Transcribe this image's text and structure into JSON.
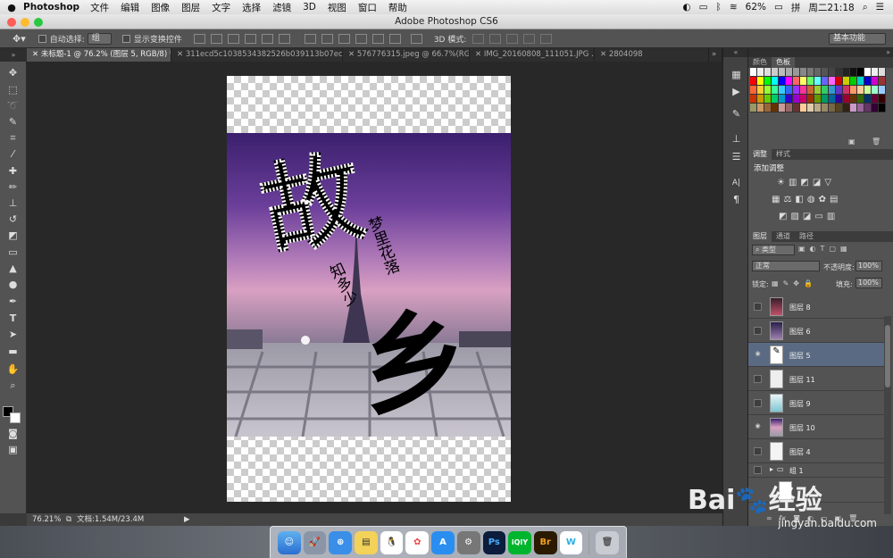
{
  "menubar": {
    "apple": "",
    "app": "Photoshop",
    "items": [
      "文件",
      "编辑",
      "图像",
      "图层",
      "文字",
      "选择",
      "滤镜",
      "3D",
      "视图",
      "窗口",
      "帮助"
    ],
    "battery": "62%",
    "input_method": "拼",
    "clock": "周二21:18"
  },
  "window": {
    "title": "Adobe Photoshop CS6"
  },
  "options": {
    "auto_select_label": "自动选择:",
    "auto_select_value": "组",
    "show_transform_label": "显示变换控件",
    "mode_3d_label": "3D 模式:",
    "workspace": "基本功能"
  },
  "tabs": [
    "未标题-1 @ 76.2% (图层 5, RGB/8) *",
    "311ecd5c1038534382526b039113b07eca808823.jpg",
    "576776315.jpeg @ 66.7%(RG...",
    "IMG_20160808_111051.JPG ...",
    "2804098"
  ],
  "tabs_overflow": "»",
  "status": {
    "zoom": "76.21%",
    "doc": "文档:1.54M/23.4M"
  },
  "swatch_panel": {
    "tabs": [
      "颜色",
      "色板"
    ]
  },
  "adjust_panel": {
    "tabs": [
      "调整",
      "样式"
    ],
    "heading": "添加调整"
  },
  "layers_panel": {
    "tabs": [
      "图层",
      "通道",
      "路径"
    ],
    "filter": "类型",
    "blend_mode": "正常",
    "opacity_label": "不透明度:",
    "opacity_value": "100%",
    "lock_label": "锁定:",
    "fill_label": "填充:",
    "fill_value": "100%",
    "layers": [
      {
        "name": "图层 8",
        "visible": false
      },
      {
        "name": "图层 6",
        "visible": false
      },
      {
        "name": "图层 5",
        "visible": true,
        "selected": true
      },
      {
        "name": "图层 11",
        "visible": false
      },
      {
        "name": "图层 9",
        "visible": false
      },
      {
        "name": "图层 10",
        "visible": true
      },
      {
        "name": "图层 4",
        "visible": false
      }
    ],
    "group": "组 1"
  },
  "artwork": {
    "calligraphy_top": "故",
    "calligraphy_bottom": "乡",
    "verse_1": "梦里花落",
    "verse_2": "知多少"
  },
  "watermark": "Bai🐾经验",
  "watermark_url": "jingyan.baidu.com",
  "colors": {
    "accent_selected_layer": "#5a6a82",
    "panel_bg": "#535353",
    "canvas_bg": "#282828"
  }
}
